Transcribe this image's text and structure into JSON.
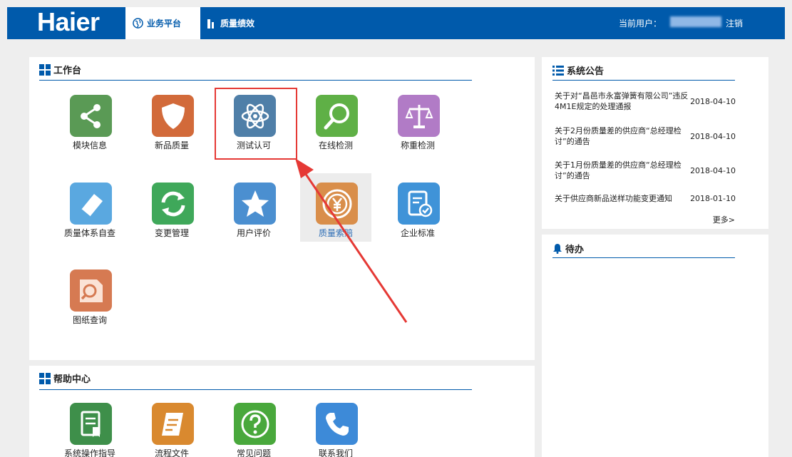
{
  "header": {
    "logo": "Haier",
    "tabs": [
      {
        "label": "业务平台",
        "active": true
      },
      {
        "label": "质量绩效",
        "active": false
      }
    ],
    "user_label": "当前用户：",
    "logout": "注销"
  },
  "workbench": {
    "title": "工作台",
    "apps": [
      {
        "label": "模块信息",
        "icon": "share-icon",
        "color": "#5a9a55"
      },
      {
        "label": "新品质量",
        "icon": "shield-icon",
        "color": "#d26a3a"
      },
      {
        "label": "测试认可",
        "icon": "atom-icon",
        "color": "#4f7fa8"
      },
      {
        "label": "在线检测",
        "icon": "magnifier-icon",
        "color": "#5fb046"
      },
      {
        "label": "称重检测",
        "icon": "scale-icon",
        "color": "#b17bc6"
      },
      {
        "label": "质量体系自查",
        "icon": "eraser-icon",
        "color": "#5aa8e0"
      },
      {
        "label": "变更管理",
        "icon": "refresh-icon",
        "color": "#3fa85a"
      },
      {
        "label": "用户评价",
        "icon": "star-icon",
        "color": "#4b8fd0"
      },
      {
        "label": "质量索赔",
        "icon": "yen-coin-icon",
        "color": "#d98e4a"
      },
      {
        "label": "企业标准",
        "icon": "checklist-icon",
        "color": "#3f93d8"
      },
      {
        "label": "图纸查询",
        "icon": "search-doc-icon",
        "color": "#d67a52"
      }
    ]
  },
  "help": {
    "title": "帮助中心",
    "apps": [
      {
        "label": "系统操作指导",
        "icon": "guide-icon",
        "color": "#3e8f4a"
      },
      {
        "label": "流程文件",
        "icon": "document-icon",
        "color": "#d9892f"
      },
      {
        "label": "常见问题",
        "icon": "question-icon",
        "color": "#49a83c"
      },
      {
        "label": "联系我们",
        "icon": "phone-icon",
        "color": "#3d8ad8"
      }
    ]
  },
  "notices": {
    "title": "系统公告",
    "items": [
      {
        "title": "关于对“昌邑市永富弹簧有限公司”违反4M1E规定的处理通报",
        "date": "2018-04-10"
      },
      {
        "title": "关于2月份质量差的供应商“总经理检讨”的通告",
        "date": "2018-04-10"
      },
      {
        "title": "关于1月份质量差的供应商“总经理检讨”的通告",
        "date": "2018-04-10"
      },
      {
        "title": "关于供应商新品送样功能变更通知",
        "date": "2018-01-10"
      }
    ],
    "more": "更多>"
  },
  "todo": {
    "title": "待办"
  }
}
